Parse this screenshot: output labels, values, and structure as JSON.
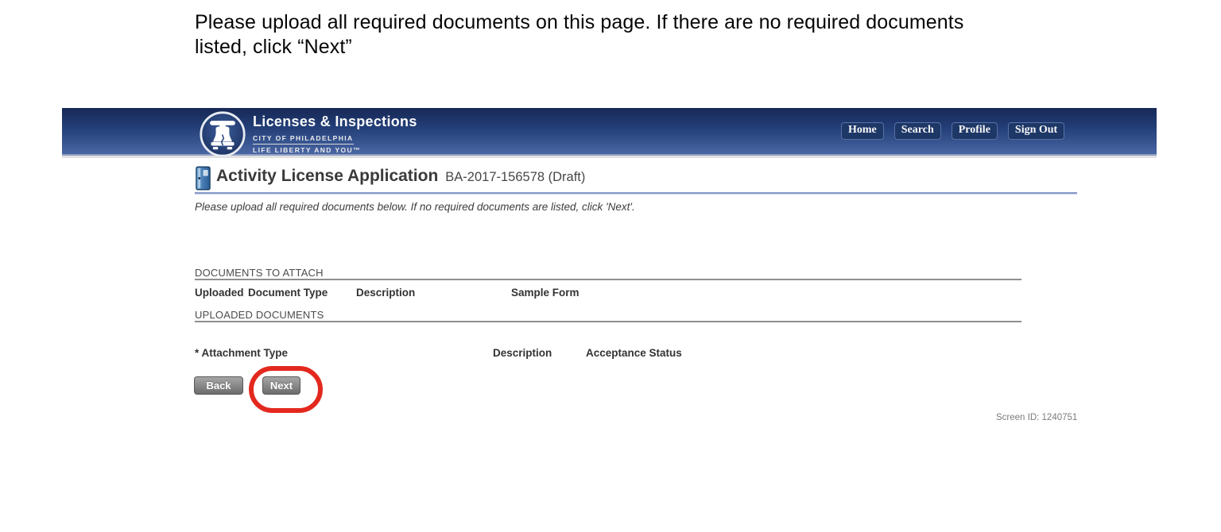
{
  "annotation": {
    "instruction": "Please upload all required documents on this page. If there are no required documents listed, click “Next”",
    "highlight_color": "#e3281e"
  },
  "header": {
    "brand": {
      "title": "Licenses & Inspections",
      "tagline1": "CITY OF PHILADELPHIA",
      "tagline2": "LIFE LIBERTY AND YOU™"
    },
    "nav": [
      {
        "label": "Home"
      },
      {
        "label": "Search"
      },
      {
        "label": "Profile"
      },
      {
        "label": "Sign Out"
      }
    ]
  },
  "page": {
    "title": "Activity License Application",
    "record_id": "BA-2017-156578 (Draft)",
    "note": "Please upload all required documents below. If no required documents are listed, click 'Next'.",
    "documents_to_attach": {
      "heading": "DOCUMENTS TO ATTACH",
      "columns": [
        "Uploaded",
        "Document Type",
        "Description",
        "Sample Form"
      ],
      "rows": []
    },
    "uploaded_documents": {
      "heading": "UPLOADED DOCUMENTS",
      "columns": [
        "* Attachment Type",
        "Description",
        "Acceptance Status"
      ],
      "rows": []
    },
    "buttons": {
      "back": "Back",
      "next": "Next"
    },
    "screen_id": "Screen ID: 1240751"
  },
  "colors": {
    "header_gradient_top": "#172955",
    "header_gradient_bottom": "#4a66a3",
    "title_underline": "#8799c7",
    "section_line": "#8f8f8f",
    "annotation_red": "#e3281e"
  }
}
